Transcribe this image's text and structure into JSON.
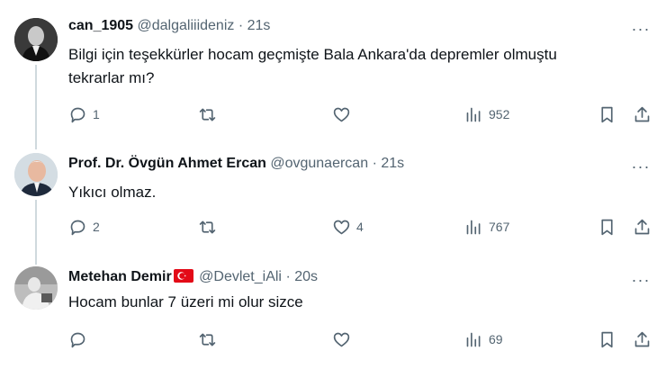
{
  "tweets": [
    {
      "name": "can_1905",
      "handle": "@dalgaliiideniz",
      "sep": "·",
      "time": "21s",
      "text": "Bilgi için teşekkürler hocam geçmişte Bala Ankara'da depremler olmuştu tekrarlar mı?",
      "replies": "1",
      "retweets": "",
      "likes": "",
      "views": "952"
    },
    {
      "name": "Prof. Dr. Övgün Ahmet Ercan",
      "handle": "@ovgunaercan",
      "sep": "·",
      "time": "21s",
      "text": "Yıkıcı olmaz.",
      "replies": "2",
      "retweets": "",
      "likes": "4",
      "views": "767"
    },
    {
      "name": "Metehan Demir",
      "handle": "@Devlet_iAli",
      "sep": "·",
      "time": "20s",
      "text": "Hocam bunlar 7 üzeri mi olur sizce",
      "replies": "",
      "retweets": "",
      "likes": "",
      "views": "69"
    }
  ],
  "more_glyph": "···",
  "colors": {
    "text": "#0f1419",
    "secondary": "#536471",
    "thread_line": "#cfd9de",
    "flag_red": "#e30a17"
  },
  "icons": [
    "reply-icon",
    "retweet-icon",
    "like-icon",
    "views-icon",
    "bookmark-icon",
    "share-icon",
    "more-icon",
    "turkey-flag-icon"
  ]
}
